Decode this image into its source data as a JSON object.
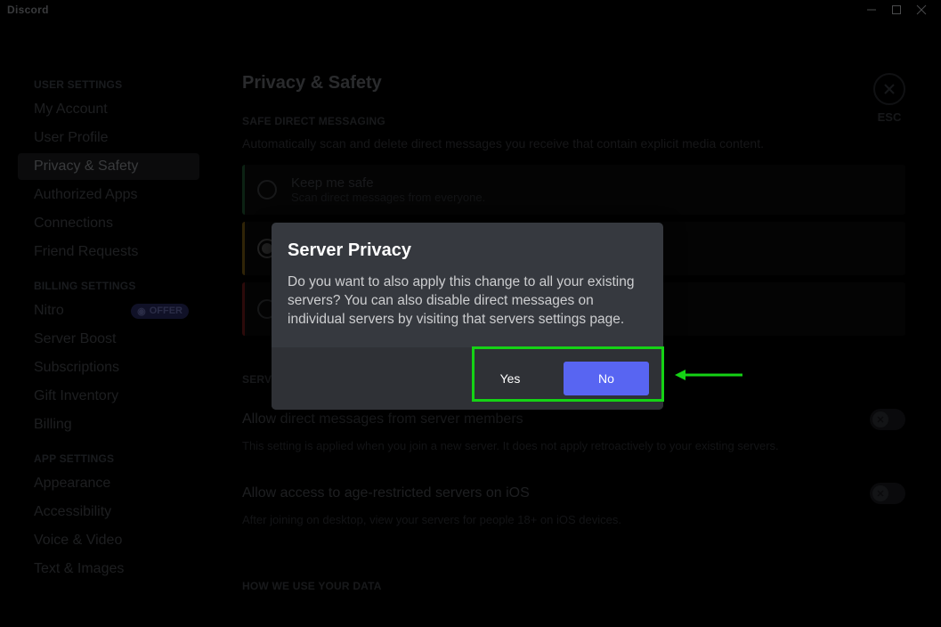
{
  "titlebar": {
    "label": "Discord"
  },
  "esc_label": "ESC",
  "page_title": "Privacy & Safety",
  "sidebar": {
    "sections": [
      {
        "head": "USER SETTINGS",
        "items": [
          {
            "label": "My Account"
          },
          {
            "label": "User Profile"
          },
          {
            "label": "Privacy & Safety"
          },
          {
            "label": "Authorized Apps"
          },
          {
            "label": "Connections"
          },
          {
            "label": "Friend Requests"
          }
        ]
      },
      {
        "head": "BILLING SETTINGS",
        "items": [
          {
            "label": "Nitro",
            "badge": "OFFER"
          },
          {
            "label": "Server Boost"
          },
          {
            "label": "Subscriptions"
          },
          {
            "label": "Gift Inventory"
          },
          {
            "label": "Billing"
          }
        ]
      },
      {
        "head": "APP SETTINGS",
        "items": [
          {
            "label": "Appearance"
          },
          {
            "label": "Accessibility"
          },
          {
            "label": "Voice & Video"
          },
          {
            "label": "Text & Images"
          }
        ]
      }
    ]
  },
  "safe_dm": {
    "head": "SAFE DIRECT MESSAGING",
    "desc": "Automatically scan and delete direct messages you receive that contain explicit media content.",
    "options": [
      {
        "title": "Keep me safe",
        "hint": "Scan direct messages from everyone."
      },
      {
        "title": "",
        "hint": ""
      },
      {
        "title": "",
        "hint": ""
      }
    ]
  },
  "server_defaults": {
    "head": "SERVER PRIVACY DEFAULTS",
    "allow_dm": {
      "title": "Allow direct messages from server members",
      "desc": "This setting is applied when you join a new server. It does not apply retroactively to your existing servers."
    },
    "age_restricted": {
      "title": "Allow access to age-restricted servers on iOS",
      "desc": "After joining on desktop, view your servers for people 18+ on iOS devices."
    }
  },
  "data_usage": {
    "head": "HOW WE USE YOUR DATA"
  },
  "modal": {
    "title": "Server Privacy",
    "body": "Do you want to also apply this change to all your existing servers? You can also disable direct messages on individual servers by visiting that servers settings page.",
    "yes": "Yes",
    "no": "No"
  }
}
